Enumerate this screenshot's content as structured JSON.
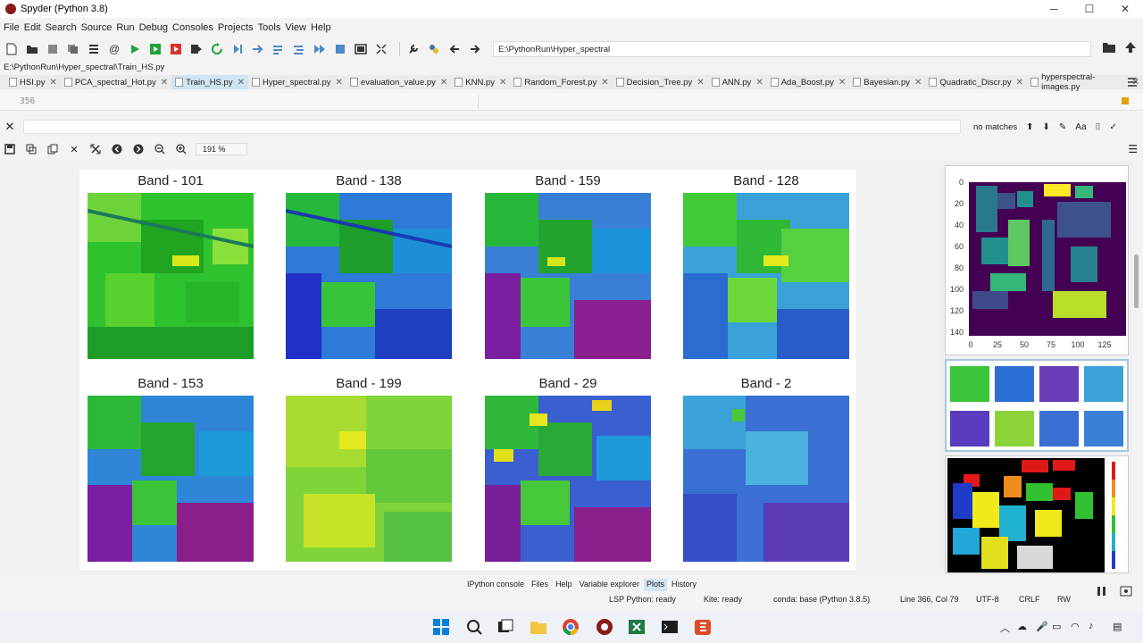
{
  "window": {
    "title": "Spyder (Python 3.8)",
    "controls": [
      "─",
      "☐",
      "✕"
    ]
  },
  "menu": [
    "File",
    "Edit",
    "Search",
    "Source",
    "Run",
    "Debug",
    "Consoles",
    "Projects",
    "Tools",
    "View",
    "Help"
  ],
  "toolbar": {
    "path": "E:\\PythonRun\\Hyper_spectral"
  },
  "editor": {
    "file_path": "E:\\PythonRun\\Hyper_spectral\\Train_HS.py",
    "line_number": "356"
  },
  "tabs": [
    {
      "label": "HSI.py"
    },
    {
      "label": "PCA_spectral_Hot.py"
    },
    {
      "label": "Train_HS.py",
      "active": true
    },
    {
      "label": "Hyper_spectral.py"
    },
    {
      "label": "evaluation_value.py"
    },
    {
      "label": "KNN.py"
    },
    {
      "label": "Random_Forest.py"
    },
    {
      "label": "Decision_Tree.py"
    },
    {
      "label": "ANN.py"
    },
    {
      "label": "Ada_Boost.py"
    },
    {
      "label": "Bayesian.py"
    },
    {
      "label": "Quadratic_Discr.py"
    },
    {
      "label": "hyperspectral-images.py"
    }
  ],
  "find": {
    "status": "no matches",
    "case_label": "Aa"
  },
  "plots": {
    "zoom": "191 %",
    "bands": [
      "Band - 101",
      "Band - 138",
      "Band - 159",
      "Band - 128",
      "Band - 153",
      "Band - 199",
      "Band - 29",
      "Band - 2"
    ]
  },
  "thumbnail_axes": {
    "y_ticks": [
      "0",
      "20",
      "40",
      "60",
      "80",
      "100",
      "120",
      "140"
    ],
    "x_ticks": [
      "0",
      "25",
      "50",
      "75",
      "100",
      "125"
    ]
  },
  "pane_tabs": [
    "IPython console",
    "Files",
    "Help",
    "Variable explorer",
    "Plots",
    "History"
  ],
  "active_pane_tab": "Plots",
  "status": {
    "lsp": "LSP Python: ready",
    "kite": "Kite: ready",
    "conda": "conda: base (Python 3.8.5)",
    "position": "Line 366, Col 79",
    "encoding": "UTF-8",
    "eol": "CRLF",
    "mode": "RW"
  }
}
